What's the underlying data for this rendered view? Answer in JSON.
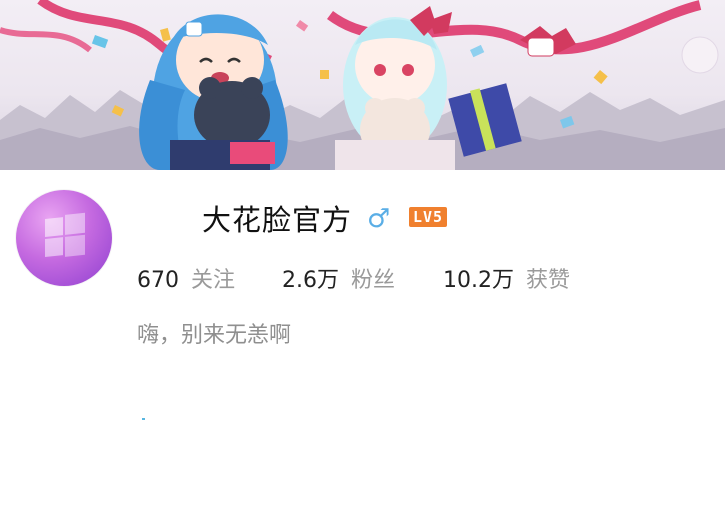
{
  "profile": {
    "name": "大花脸官方",
    "gender_symbol": "♂",
    "level_badge": "LV5",
    "bio": "嗨，别来无恙啊",
    "accent_color": "#f0802e",
    "gender_color": "#5aaee6"
  },
  "stats": [
    {
      "value": "670",
      "label": "关注"
    },
    {
      "value": "2.6万",
      "label": "粉丝"
    },
    {
      "value": "10.2万",
      "label": "获赞"
    }
  ],
  "icons": {
    "avatar": "windows-logo-icon",
    "gender": "male-icon"
  }
}
